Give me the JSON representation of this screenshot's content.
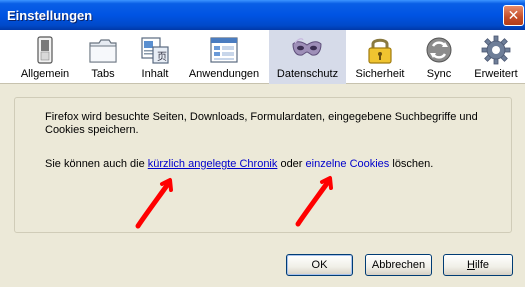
{
  "window": {
    "title": "Einstellungen",
    "close_symbol": "✕"
  },
  "tabs": [
    {
      "label": "Allgemein",
      "icon": "switch-icon"
    },
    {
      "label": "Tabs",
      "icon": "folder-tabs-icon"
    },
    {
      "label": "Inhalt",
      "icon": "content-icon"
    },
    {
      "label": "Anwendungen",
      "icon": "applications-icon"
    },
    {
      "label": "Datenschutz",
      "icon": "mask-icon",
      "selected": true
    },
    {
      "label": "Sicherheit",
      "icon": "lock-icon"
    },
    {
      "label": "Sync",
      "icon": "sync-icon"
    },
    {
      "label": "Erweitert",
      "icon": "gear-icon"
    }
  ],
  "privacy": {
    "paragraph1": "Firefox wird besuchte Seiten, Downloads, Formulardaten, eingegebene Suchbegriffe und Cookies speichern.",
    "p2_before": "Sie können auch die ",
    "link_history": "kürzlich angelegte Chronik",
    "p2_middle": " oder ",
    "link_cookies": "einzelne Cookies",
    "p2_after": " löschen."
  },
  "buttons": {
    "ok": "OK",
    "cancel": "Abbrechen",
    "help_first": "H",
    "help_rest": "ilfe"
  },
  "colors": {
    "titlebar": "#0054e3",
    "link": "#0000cc",
    "annotation_arrow": "#ff0000"
  }
}
